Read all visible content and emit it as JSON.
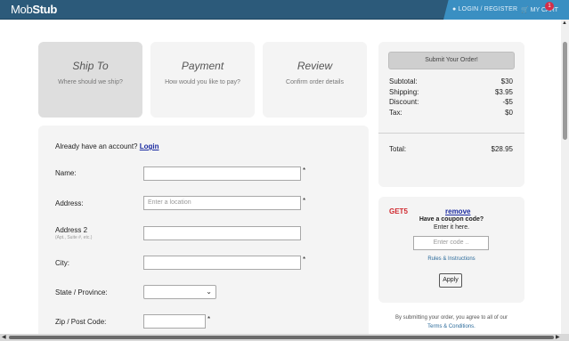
{
  "header": {
    "logo_a": "Mob",
    "logo_b": "Stub",
    "login_label": "LOGIN / REGISTER",
    "cart_label": "MY CART",
    "cart_count": "1"
  },
  "steps": [
    {
      "title": "Ship To",
      "sub": "Where should we ship?"
    },
    {
      "title": "Payment",
      "sub": "How would you like to pay?"
    },
    {
      "title": "Review",
      "sub": "Confirm order details"
    }
  ],
  "form": {
    "already_text": "Already have an account?",
    "login_link": "Login",
    "name_label": "Name:",
    "address_label": "Address:",
    "address_placeholder": "Enter a location",
    "address2_label": "Address 2",
    "address2_hint": "(Apt., Suite #, etc.)",
    "city_label": "City:",
    "state_label": "State / Province:",
    "zip_label": "Zip / Post Code:",
    "required_mark": "*"
  },
  "summary": {
    "submit_label": "Submit Your Order!",
    "subtotal_label": "Subtotal:",
    "subtotal_value": "$30",
    "shipping_label": "Shipping:",
    "shipping_value": "$3.95",
    "discount_label": "Discount:",
    "discount_value": "-$5",
    "tax_label": "Tax:",
    "tax_value": "$0",
    "total_label": "Total:",
    "total_value": "$28.95"
  },
  "coupon": {
    "code": "GET5",
    "remove_label": "remove",
    "have_text": "Have a coupon code?",
    "enter_text": "Enter it here.",
    "input_placeholder": "Enter code ..",
    "rules_label": "Rules & Instructions",
    "apply_label": "Apply"
  },
  "footer": {
    "agree_text": "By submitting your order, you agree to all of our",
    "terms_label": "Terms & Conditions."
  },
  "icons": {
    "user": "user-icon",
    "cart": "cart-icon"
  },
  "colors": {
    "header": "#2c5a7a",
    "accent": "#3a8fc2",
    "badge": "#d32f4a",
    "coupon_code": "#d0282e",
    "link": "#1a2aa0"
  }
}
